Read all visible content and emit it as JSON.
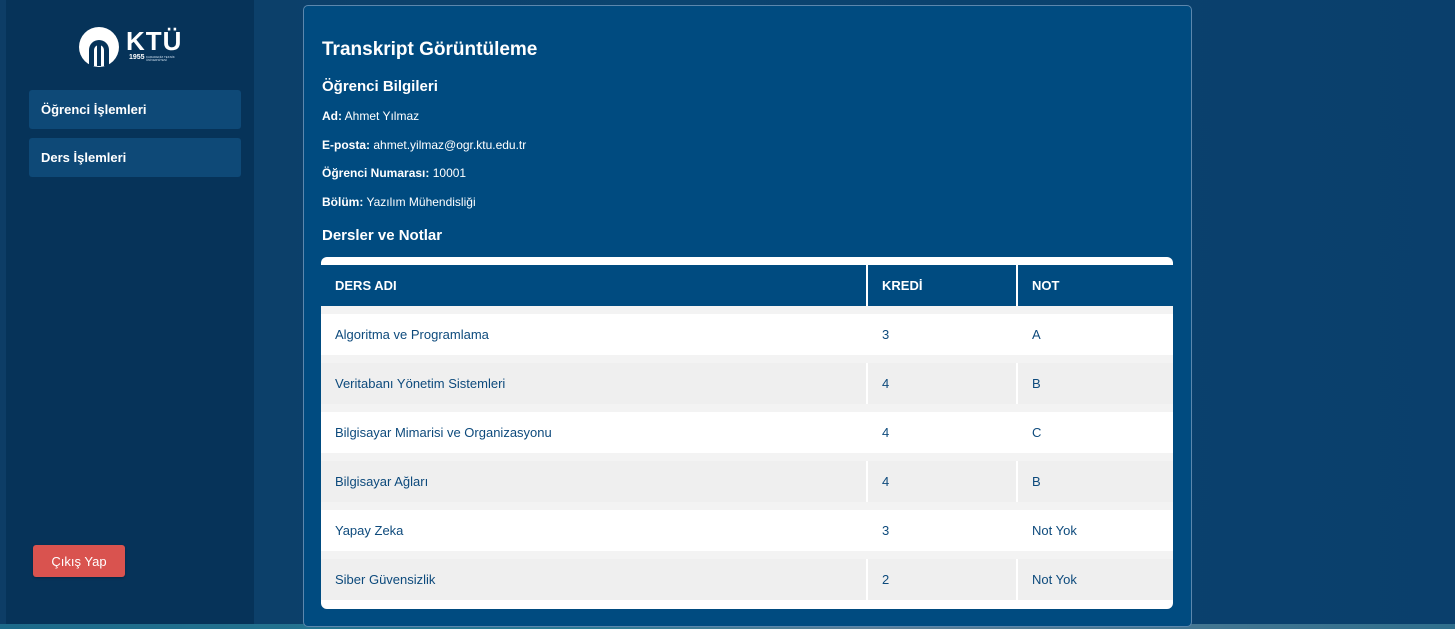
{
  "sidebar": {
    "logo_text": "KTÜ",
    "logo_year": "1955",
    "logo_subtext": "KARADENİZ TEKNİK ÜNİVERSİTESİ",
    "items": [
      {
        "label": "Öğrenci İşlemleri"
      },
      {
        "label": "Ders İşlemleri"
      }
    ],
    "logout_label": "Çıkış Yap"
  },
  "main": {
    "title": "Transkript Görüntüleme",
    "student_section_title": "Öğrenci Bilgileri",
    "student": {
      "name_label": "Ad:",
      "name": "Ahmet Yılmaz",
      "email_label": "E-posta:",
      "email": "ahmet.yilmaz@ogr.ktu.edu.tr",
      "number_label": "Öğrenci Numarası:",
      "number": "10001",
      "department_label": "Bölüm:",
      "department": "Yazılım Mühendisliği"
    },
    "courses_section_title": "Dersler ve Notlar",
    "table": {
      "headers": [
        "DERS ADI",
        "KREDİ",
        "NOT"
      ],
      "rows": [
        [
          "Algoritma ve Programlama",
          "3",
          "A"
        ],
        [
          "Veritabanı Yönetim Sistemleri",
          "4",
          "B"
        ],
        [
          "Bilgisayar Mimarisi ve Organizasyonu",
          "4",
          "C"
        ],
        [
          "Bilgisayar Ağları",
          "4",
          "B"
        ],
        [
          "Yapay Zeka",
          "3",
          "Not Yok"
        ],
        [
          "Siber Güvensizlik",
          "2",
          "Not Yok"
        ]
      ]
    }
  },
  "colors": {
    "sidebar_bg": "#063359",
    "card_bg": "#004b80",
    "logout_bg": "#d9534f",
    "row_text": "#0d4a7c"
  }
}
